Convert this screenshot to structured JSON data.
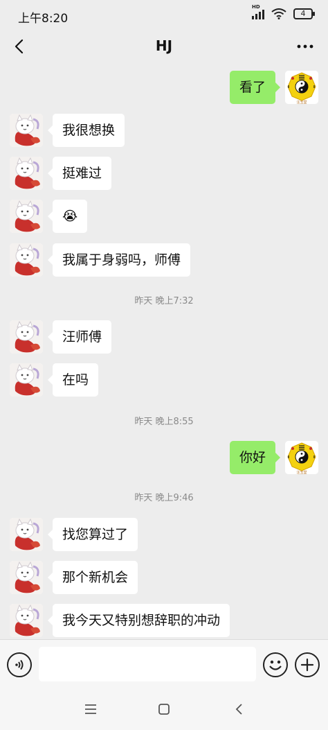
{
  "status_bar": {
    "time": "上午8:20",
    "network_tag": "HD",
    "battery_level": "4"
  },
  "nav": {
    "title": "HJ"
  },
  "messages": [
    {
      "type": "msg",
      "side": "right",
      "text": "看了",
      "avatar": "bagua-avatar"
    },
    {
      "type": "msg",
      "side": "left",
      "text": "我很想换",
      "avatar": "koi-cat-avatar"
    },
    {
      "type": "msg",
      "side": "left",
      "text": "挺难过",
      "avatar": "koi-cat-avatar"
    },
    {
      "type": "msg",
      "side": "left",
      "text": "😭",
      "avatar": "koi-cat-avatar"
    },
    {
      "type": "msg",
      "side": "left",
      "text": "我属于身弱吗，师傅",
      "avatar": "koi-cat-avatar"
    },
    {
      "type": "time",
      "text": "昨天 晚上7:32"
    },
    {
      "type": "msg",
      "side": "left",
      "text": "汪师傅",
      "avatar": "koi-cat-avatar"
    },
    {
      "type": "msg",
      "side": "left",
      "text": "在吗",
      "avatar": "koi-cat-avatar"
    },
    {
      "type": "time",
      "text": "昨天 晚上8:55"
    },
    {
      "type": "msg",
      "side": "right",
      "text": "你好",
      "avatar": "bagua-avatar"
    },
    {
      "type": "time",
      "text": "昨天 晚上9:46"
    },
    {
      "type": "msg",
      "side": "left",
      "text": "找您算过了",
      "avatar": "koi-cat-avatar"
    },
    {
      "type": "msg",
      "side": "left",
      "text": "那个新机会",
      "avatar": "koi-cat-avatar"
    },
    {
      "type": "msg",
      "side": "left",
      "text": "我今天又特别想辞职的冲动",
      "avatar": "koi-cat-avatar"
    }
  ],
  "input": {
    "placeholder": ""
  },
  "colors": {
    "background": "#ededed",
    "self_bubble": "#95ec69",
    "other_bubble": "#ffffff",
    "timestamp": "#8a8a8a"
  },
  "icons": [
    "back-icon",
    "more-icon",
    "voice-icon",
    "emoji-icon",
    "plus-icon",
    "menu-icon",
    "home-icon",
    "nav-back-icon"
  ]
}
